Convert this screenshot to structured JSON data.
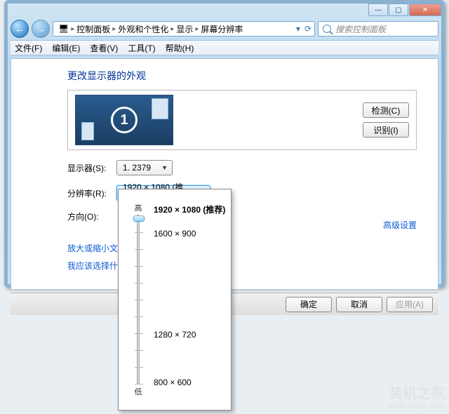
{
  "window_buttons": {
    "min": "—",
    "max": "▢",
    "close": "✕"
  },
  "nav": {
    "back": "←",
    "forward": "→",
    "refresh": "⟳"
  },
  "breadcrumb": {
    "icon": "🖥",
    "s0": "控制面板",
    "s1": "外观和个性化",
    "s2": "显示",
    "s3": "屏幕分辨率"
  },
  "search": {
    "placeholder": "搜索控制面板"
  },
  "menu": {
    "m0": "文件(F)",
    "m1": "编辑(E)",
    "m2": "查看(V)",
    "m3": "工具(T)",
    "m4": "帮助(H)"
  },
  "heading": "更改显示器的外观",
  "monitor_number": "1",
  "buttons": {
    "detect": "检测(C)",
    "identify": "识别(I)"
  },
  "labels": {
    "display": "显示器(S):",
    "resolution": "分辨率(R):",
    "orientation": "方向(O):"
  },
  "display_value": "1. 2379",
  "resolution_value": "1920 × 1080 (推荐)",
  "links": {
    "resize": "放大或缩小文本和其他项目",
    "which": "我应该选择什么显示器设置?",
    "advanced": "高级设置"
  },
  "dialog_buttons": {
    "ok": "确定",
    "cancel": "取消",
    "apply": "应用(A)"
  },
  "slider": {
    "high": "高",
    "low": "低"
  },
  "resolutions": {
    "r0": "1920 × 1080 (推荐)",
    "r1": "1600 × 900",
    "r2": "1280 × 720",
    "r3": "800 × 600"
  },
  "watermark": {
    "title": "装机之家",
    "sub": "www.lotpc.com"
  }
}
